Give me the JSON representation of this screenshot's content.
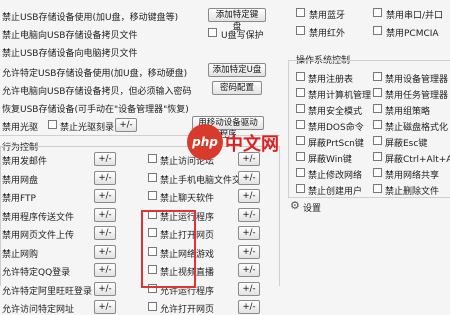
{
  "left_top": {
    "rows": [
      {
        "label": "禁止USB存储设备使用(加U盘，移动键盘等)",
        "button": "添加特定键盘"
      },
      {
        "label": "禁止电脑向USB存储设备拷贝文件",
        "checkbox": "U盘写保护"
      },
      {
        "label": "禁止USB存储设备向电脑拷贝文件"
      },
      {
        "label": "允许特定USB存储设备使用(加U盘，移动硬盘)",
        "button": "添加特定U盘"
      },
      {
        "label": "允许电脑向USB存储设备拷贝，但必须输入密码",
        "button": "密码配置"
      },
      {
        "label": "恢复USB存储设备(可手动在\"设备管理器\"恢复)",
        "button": "用移动设备驱动程序"
      },
      {
        "label": "禁用光驱",
        "checkbox": "禁止光驱刻录",
        "small_button": "+/-"
      }
    ]
  },
  "left_section_title": "行为控制",
  "left_items": [
    {
      "label": "禁用发邮件",
      "btn": "+/-",
      "chk": "禁止访问论坛",
      "btn2": "+/-"
    },
    {
      "label": "禁用网盘",
      "btn": "+/-",
      "chk": "禁止手机电脑文件交换",
      "btn2": "+/-"
    },
    {
      "label": "禁用FTP",
      "btn": "+/-",
      "chk": "禁止聊天软件",
      "btn2": "+/-"
    },
    {
      "label": "禁用程序传送文件",
      "btn": "+/-",
      "chk": "禁止运行程序",
      "btn2": "+/-"
    },
    {
      "label": "禁用网页文件上传",
      "btn": "+/-",
      "chk": "禁止打开网页",
      "btn2": "+/-"
    },
    {
      "label": "禁止网购",
      "btn": "+/-",
      "chk": "禁止网络游戏",
      "btn2": "+/-"
    },
    {
      "label": "允许特定QQ登录",
      "btn": "+/-",
      "chk": "禁止视频直播",
      "btn2": "+/-"
    },
    {
      "label": "允许特定阿里旺旺登录",
      "btn": "+/-",
      "chk": "允许运行程序",
      "btn2": "+/-"
    },
    {
      "label": "允许访问特定网址",
      "btn": "+/-",
      "chk": "允许打开网页",
      "btn2": "+/-"
    }
  ],
  "right_top": [
    {
      "left": "禁用蓝牙",
      "right": "禁用串口/并口"
    },
    {
      "left": "禁用红外",
      "right": "禁用PCMCIA"
    }
  ],
  "right_section_title": "操作系统控制",
  "right_items": [
    [
      "禁用注册表",
      "禁用设备管理器"
    ],
    [
      "禁用计算机管理",
      "禁用任务管理器"
    ],
    [
      "禁用安全模式",
      "禁用组策略"
    ],
    [
      "禁用DOS命令",
      "禁止磁盘格式化"
    ],
    [
      "屏蔽PrtScn键",
      "屏蔽Esc键"
    ],
    [
      "屏蔽Win键",
      "屏蔽Ctrl+Alt+A键"
    ],
    [
      "禁止修改网络",
      "禁用网络共享"
    ],
    [
      "禁止创建用户",
      "禁止删除文件"
    ]
  ],
  "right_bottom_title": "设置",
  "watermark": {
    "logo": "php",
    "text": "中文网"
  },
  "colors": {
    "highlight": "#e03434",
    "watermark_red": "#d83b2b"
  }
}
